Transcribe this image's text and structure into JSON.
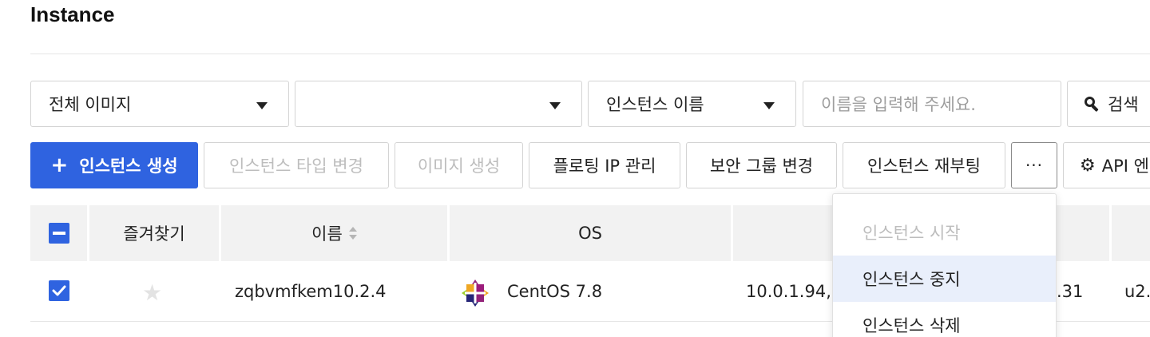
{
  "page": {
    "title": "Instance"
  },
  "filters": {
    "image_select": "전체 이미지",
    "second_select": "",
    "field_select": "인스턴스 이름",
    "search_placeholder": "이름을 입력해 주세요.",
    "search_button": "검색"
  },
  "toolbar": {
    "create": "인스턴스 생성",
    "change_type": "인스턴스 타입 변경",
    "create_image": "이미지 생성",
    "floating_ip": "플로팅 IP 관리",
    "security_group": "보안 그룹 변경",
    "reboot": "인스턴스 재부팅",
    "more": "···",
    "api": "API 엔"
  },
  "table": {
    "headers": {
      "favorite": "즐겨찾기",
      "name": "이름",
      "os": "OS"
    },
    "rows": [
      {
        "name": "zqbvmfkem10.2.4",
        "os": "CentOS 7.8",
        "ip": "10.0.1.94,",
        "ip2": ".31",
        "extra": "u2."
      }
    ]
  },
  "dropdown": {
    "items": [
      {
        "label": "인스턴스 시작",
        "state": "disabled"
      },
      {
        "label": "인스턴스 중지",
        "state": "hover"
      },
      {
        "label": "인스턴스 삭제",
        "state": "normal"
      }
    ]
  },
  "colors": {
    "primary": "#2f63e0",
    "header_bg": "#f2f2f2",
    "hover": "#e9effb"
  },
  "icons": {
    "search": "search-icon",
    "gear": "gear-icon",
    "star": "star-icon",
    "os": "centos-logo-icon"
  }
}
